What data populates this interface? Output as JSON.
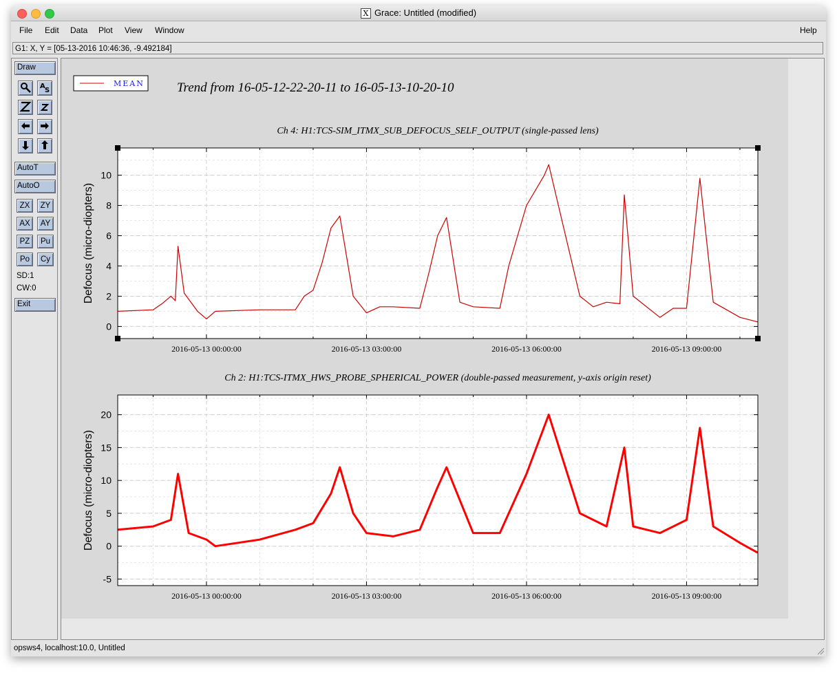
{
  "window": {
    "title": "Grace: Untitled (modified)",
    "x_logo": "X"
  },
  "menubar": {
    "items": [
      "File",
      "Edit",
      "Data",
      "Plot",
      "View",
      "Window"
    ],
    "help": "Help"
  },
  "locator": "G1: X, Y = [05-13-2016 10:46:36, -9.492184]",
  "toolbar": {
    "draw": "Draw",
    "icons": [
      "zoom-icon",
      "autoscale-text-icon",
      "zoom-in-icon",
      "zoom-out-icon",
      "arrow-left-icon",
      "arrow-right-icon",
      "arrow-down-icon",
      "arrow-up-icon"
    ],
    "autot": "AutoT",
    "autoo": "AutoO",
    "small": [
      "ZX",
      "ZY",
      "AX",
      "AY",
      "PZ",
      "Pu",
      "Po",
      "Cy"
    ],
    "sd": "SD:1",
    "cw": "CW:0",
    "exit": "Exit"
  },
  "figure": {
    "legend": "MEAN",
    "legend_color": "#cc0000",
    "title": "Trend from 16-05-12-22-20-11 to 16-05-13-10-20-10"
  },
  "statusbar": "opsws4, localhost:10.0, Untitled",
  "chart_data": [
    {
      "type": "line",
      "title": "Ch 4: H1:TCS-SIM_ITMX_SUB_DEFOCUS_SELF_OUTPUT (single-passed lens)",
      "ylabel": "Defocus (micro-diopters)",
      "xlabel": "",
      "x_tick_labels": [
        "2016-05-13 00:00:00",
        "2016-05-13 03:00:00",
        "2016-05-13 06:00:00",
        "2016-05-13 09:00:00"
      ],
      "y_ticks": [
        0,
        2,
        4,
        6,
        8,
        10
      ],
      "ylim": [
        -0.8,
        11.8
      ],
      "xlim": [
        "2016-05-12 22:20:11",
        "2016-05-13 10:20:10"
      ],
      "grid": true,
      "color": "#cc0000",
      "series": [
        {
          "name": "MEAN",
          "x": [
            "2016-05-12 22:20",
            "2016-05-12 23:00",
            "2016-05-12 23:10",
            "2016-05-12 23:20",
            "2016-05-12 23:25",
            "2016-05-12 23:28",
            "2016-05-12 23:35",
            "2016-05-12 23:50",
            "2016-05-13 00:00",
            "2016-05-13 00:10",
            "2016-05-13 01:00",
            "2016-05-13 01:40",
            "2016-05-13 01:50",
            "2016-05-13 02:00",
            "2016-05-13 02:10",
            "2016-05-13 02:20",
            "2016-05-13 02:30",
            "2016-05-13 02:45",
            "2016-05-13 03:00",
            "2016-05-13 03:15",
            "2016-05-13 03:30",
            "2016-05-13 04:00",
            "2016-05-13 04:10",
            "2016-05-13 04:20",
            "2016-05-13 04:30",
            "2016-05-13 04:45",
            "2016-05-13 05:00",
            "2016-05-13 05:30",
            "2016-05-13 05:40",
            "2016-05-13 06:00",
            "2016-05-13 06:20",
            "2016-05-13 06:25",
            "2016-05-13 07:00",
            "2016-05-13 07:15",
            "2016-05-13 07:30",
            "2016-05-13 07:45",
            "2016-05-13 07:50",
            "2016-05-13 08:00",
            "2016-05-13 08:30",
            "2016-05-13 08:45",
            "2016-05-13 09:00",
            "2016-05-13 09:15",
            "2016-05-13 09:30",
            "2016-05-13 10:00",
            "2016-05-13 10:20"
          ],
          "y": [
            1.0,
            1.1,
            1.5,
            2.0,
            1.7,
            5.3,
            2.2,
            1.0,
            0.5,
            1.0,
            1.1,
            1.1,
            2.0,
            2.4,
            4.2,
            6.5,
            7.3,
            2.0,
            0.9,
            1.3,
            1.3,
            1.2,
            3.5,
            6.0,
            7.2,
            1.6,
            1.3,
            1.2,
            4.0,
            8.0,
            10.0,
            10.7,
            2.0,
            1.3,
            1.6,
            1.5,
            8.7,
            2.0,
            0.6,
            1.2,
            1.2,
            9.8,
            1.6,
            0.6,
            0.3
          ]
        }
      ]
    },
    {
      "type": "line",
      "title": "Ch 2: H1:TCS-ITMX_HWS_PROBE_SPHERICAL_POWER (double-passed measurement, y-axis origin reset)",
      "ylabel": "Defocus (micro-diopters)",
      "xlabel": "",
      "x_tick_labels": [
        "2016-05-13 00:00:00",
        "2016-05-13 03:00:00",
        "2016-05-13 06:00:00",
        "2016-05-13 09:00:00"
      ],
      "y_ticks": [
        -5,
        0,
        5,
        10,
        15,
        20
      ],
      "ylim": [
        -6,
        23
      ],
      "xlim": [
        "2016-05-12 22:20:11",
        "2016-05-13 10:20:10"
      ],
      "grid": true,
      "color": "#ff0000",
      "series": [
        {
          "x": [
            "2016-05-12 22:20",
            "2016-05-12 23:00",
            "2016-05-12 23:20",
            "2016-05-12 23:28",
            "2016-05-12 23:40",
            "2016-05-13 00:00",
            "2016-05-13 00:10",
            "2016-05-13 01:00",
            "2016-05-13 01:40",
            "2016-05-13 02:00",
            "2016-05-13 02:20",
            "2016-05-13 02:30",
            "2016-05-13 02:45",
            "2016-05-13 03:00",
            "2016-05-13 03:30",
            "2016-05-13 04:00",
            "2016-05-13 04:20",
            "2016-05-13 04:30",
            "2016-05-13 05:00",
            "2016-05-13 05:30",
            "2016-05-13 06:00",
            "2016-05-13 06:25",
            "2016-05-13 07:00",
            "2016-05-13 07:30",
            "2016-05-13 07:50",
            "2016-05-13 08:00",
            "2016-05-13 08:30",
            "2016-05-13 09:00",
            "2016-05-13 09:15",
            "2016-05-13 09:30",
            "2016-05-13 10:00",
            "2016-05-13 10:20"
          ],
          "y": [
            2.5,
            3.0,
            4.0,
            11.0,
            2.0,
            1.0,
            0.0,
            1.0,
            2.5,
            3.5,
            8.0,
            12.0,
            5.0,
            2.0,
            1.5,
            2.5,
            9.0,
            12.0,
            2.0,
            2.0,
            11.0,
            20.0,
            5.0,
            3.0,
            15.0,
            3.0,
            2.0,
            4.0,
            18.0,
            3.0,
            0.5,
            -1.0
          ]
        }
      ]
    }
  ]
}
